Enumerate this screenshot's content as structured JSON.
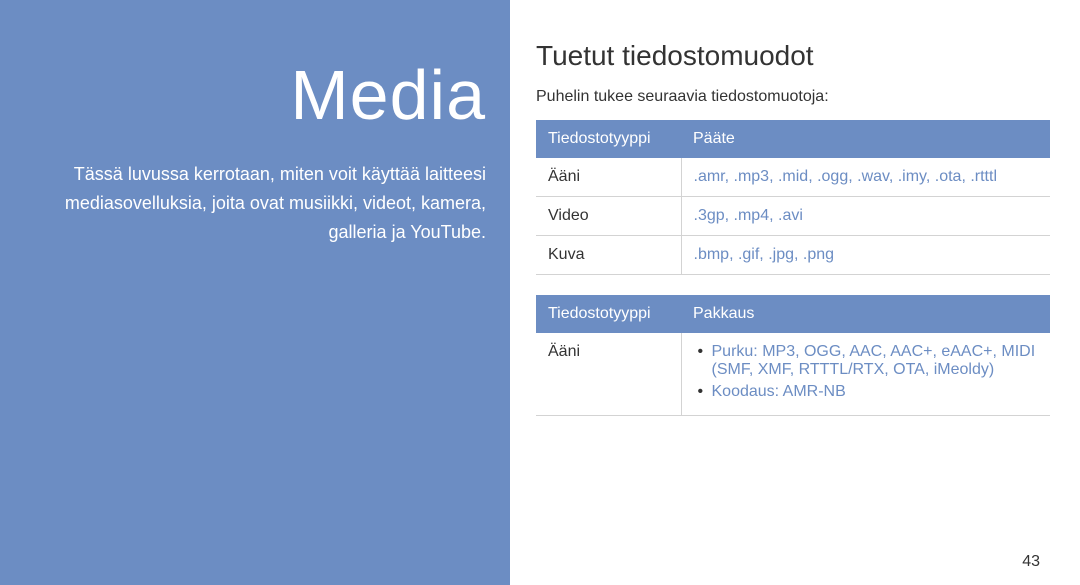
{
  "sidebar": {
    "title": "Media",
    "description": "Tässä luvussa kerrotaan, miten voit käyttää laitteesi mediasovelluksia, joita ovat musiikki, videot, kamera, galleria ja YouTube."
  },
  "main": {
    "heading": "Tuetut tiedostomuodot",
    "intro": "Puhelin tukee seuraavia tiedostomuotoja:",
    "table1": {
      "header1": "Tiedostotyyppi",
      "header2": "Pääte",
      "rows": [
        {
          "type": "Ääni",
          "ext": ".amr, .mp3, .mid, .ogg, .wav, .imy, .ota, .rtttl"
        },
        {
          "type": "Video",
          "ext": ".3gp, .mp4, .avi"
        },
        {
          "type": "Kuva",
          "ext": ".bmp, .gif, .jpg, .png"
        }
      ]
    },
    "table2": {
      "header1": "Tiedostotyyppi",
      "header2": "Pakkaus",
      "row": {
        "type": "Ääni",
        "items": [
          "Purku: MP3, OGG, AAC, AAC+, eAAC+, MIDI (SMF, XMF, RTTTL/RTX, OTA, iMeoldy)",
          "Koodaus: AMR-NB"
        ]
      }
    },
    "page_number": "43"
  }
}
